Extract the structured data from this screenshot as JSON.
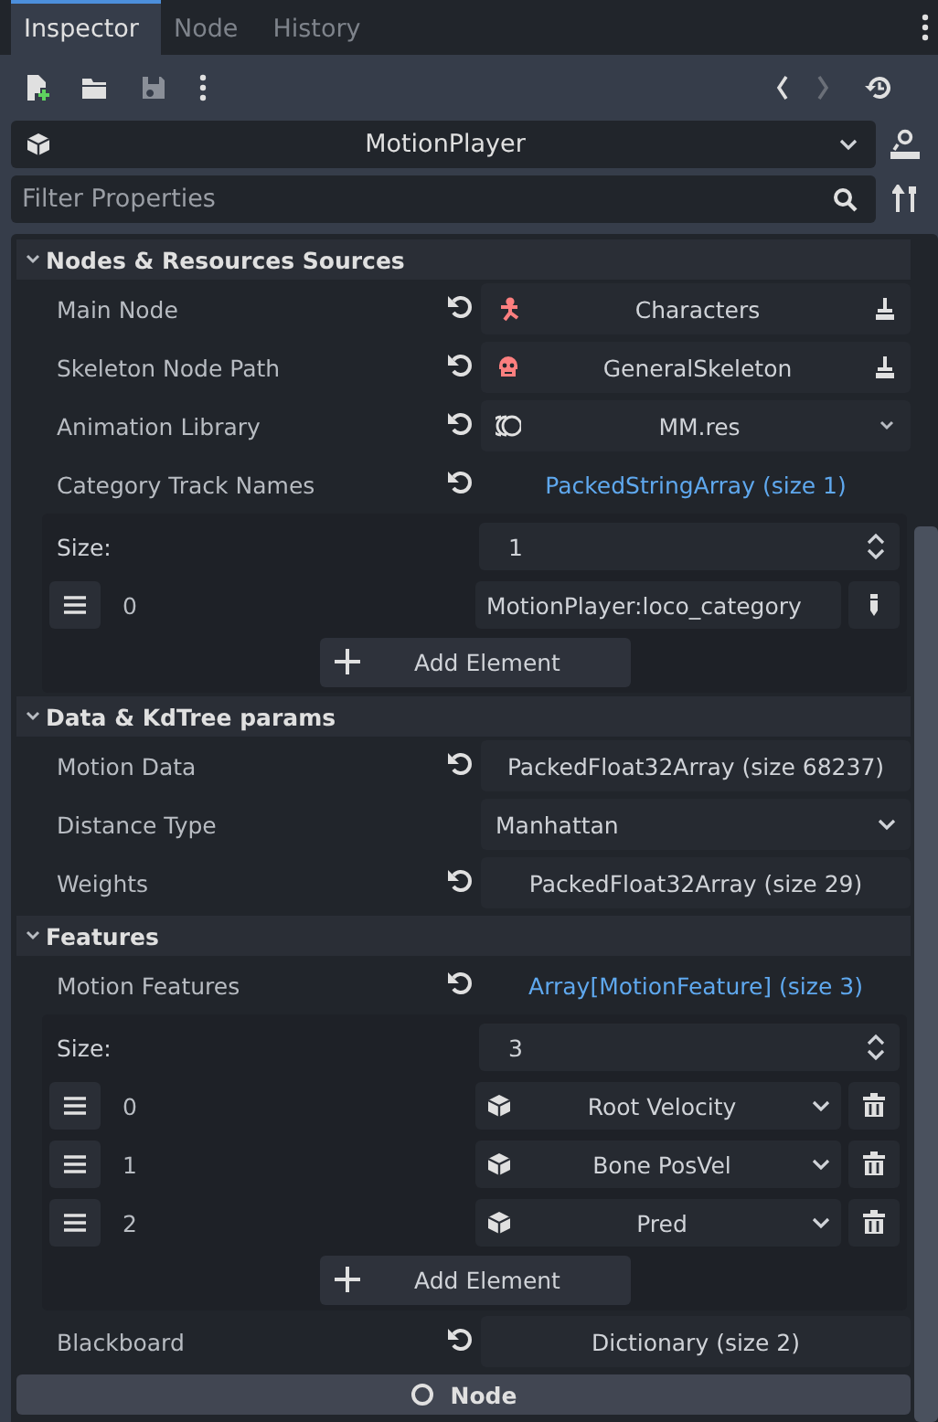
{
  "tabs": [
    {
      "label": "Inspector",
      "selected": true
    },
    {
      "label": "Node",
      "selected": false
    },
    {
      "label": "History",
      "selected": false
    }
  ],
  "toolbar": {
    "back_enabled": true,
    "forward_enabled": false,
    "save_enabled": false
  },
  "object_selector": {
    "value": "MotionPlayer"
  },
  "filter": {
    "placeholder": "Filter Properties"
  },
  "sections": [
    {
      "title": "Nodes & Resources Sources",
      "expanded": true,
      "properties": [
        {
          "kind": "node",
          "label": "Main Node",
          "revertable": true,
          "value": "Characters"
        },
        {
          "kind": "node",
          "label": "Skeleton Node Path",
          "revertable": true,
          "value": "GeneralSkeleton"
        },
        {
          "kind": "resource",
          "label": "Animation Library",
          "revertable": true,
          "value": "MM.res"
        },
        {
          "kind": "array",
          "label": "Category Track Names",
          "revertable": true,
          "value": "PackedStringArray (size 1)",
          "expanded": true,
          "size_label": "Size:",
          "size": "1",
          "add_label": "Add Element",
          "items": [
            {
              "kind": "string",
              "index": "0",
              "value": "MotionPlayer:loco_category"
            }
          ]
        }
      ]
    },
    {
      "title": "Data & KdTree params",
      "expanded": true,
      "properties": [
        {
          "kind": "text",
          "label": "Motion Data",
          "revertable": true,
          "value": "PackedFloat32Array (size 68237)"
        },
        {
          "kind": "enum",
          "label": "Distance Type",
          "revertable": false,
          "value": "Manhattan"
        },
        {
          "kind": "text",
          "label": "Weights",
          "revertable": true,
          "value": "PackedFloat32Array (size 29)"
        }
      ]
    },
    {
      "title": "Features",
      "expanded": true,
      "properties": [
        {
          "kind": "array",
          "label": "Motion Features",
          "revertable": true,
          "value": "Array[MotionFeature] (size 3)",
          "expanded": true,
          "size_label": "Size:",
          "size": "3",
          "add_label": "Add Element",
          "items": [
            {
              "kind": "resource",
              "index": "0",
              "value": "Root Velocity"
            },
            {
              "kind": "resource",
              "index": "1",
              "value": "Bone PosVel"
            },
            {
              "kind": "resource",
              "index": "2",
              "value": "Pred"
            }
          ]
        },
        {
          "kind": "text",
          "label": "Blackboard",
          "revertable": true,
          "value": "Dictionary (size 2)"
        }
      ]
    }
  ],
  "category": {
    "title": "Node"
  }
}
